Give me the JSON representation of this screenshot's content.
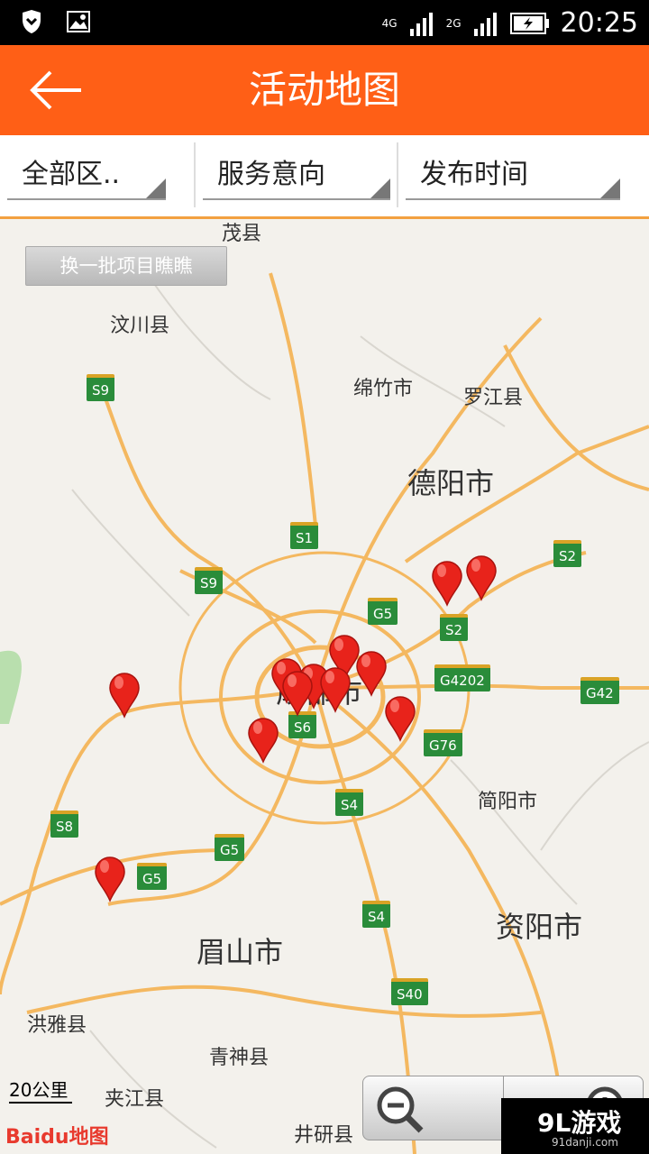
{
  "status": {
    "time": "20:25",
    "net1": "4G",
    "net2": "2G"
  },
  "header": {
    "title": "活动地图"
  },
  "filters": {
    "region": "全部区..",
    "service": "服务意向",
    "publish": "发布时间"
  },
  "map": {
    "refresh_button": "换一批项目瞧瞧",
    "scale": "20公里",
    "logo": "Baidu地图",
    "labels": {
      "maoxian": "茂县",
      "wenchuan": "汶川县",
      "mianzhu": "绵竹市",
      "luojiang": "罗江县",
      "deyang": "德阳市",
      "chengdu": "成都市",
      "jianyang": "简阳市",
      "ziyang": "资阳市",
      "meishan": "眉山市",
      "hongya": "洪雅县",
      "qingshen": "青神县",
      "jiajiang": "夹江县",
      "jingyan": "井研县"
    },
    "highways": {
      "s9a": "S9",
      "s1": "S1",
      "s9b": "S9",
      "s2a": "S2",
      "s2b": "S2",
      "g5a": "G5",
      "g4202": "G4202",
      "g42": "G42",
      "s6": "S6",
      "g76": "G76",
      "s4a": "S4",
      "s8": "S8",
      "g5b": "G5",
      "g5c": "G5",
      "s4b": "S4",
      "s40": "S40"
    }
  },
  "watermark": {
    "brand": "9L游戏",
    "site": "91danji.com"
  }
}
